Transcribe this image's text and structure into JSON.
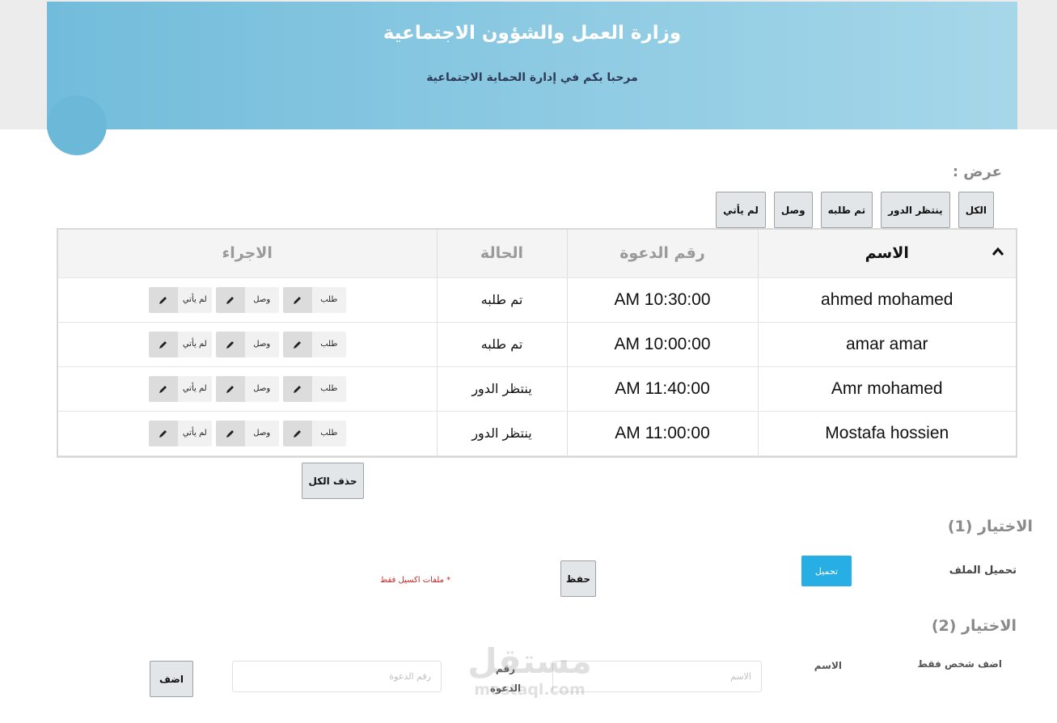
{
  "header": {
    "title": "وزارة العمل والشؤون الاجتماعية",
    "subtitle": "مرحبا بكم في إدارة الحماية الاجتماعية"
  },
  "filters": {
    "label": "عرض :",
    "buttons": [
      "الكل",
      "ينتظر الدور",
      "تم طلبه",
      "وصل",
      "لم يأتي"
    ]
  },
  "table": {
    "columns": {
      "name": "الاسم",
      "call_number": "رقم الدعوة",
      "status": "الحالة",
      "action": "الاجراء"
    },
    "sort_icon": "chevron-up-icon",
    "action_labels": {
      "request": "طلب",
      "arrived": "وصل",
      "not_came": "لم يأتي"
    },
    "rows": [
      {
        "name": "ahmed mohamed",
        "call_time": "AM 10:30:00",
        "status": "تم طلبه"
      },
      {
        "name": "amar amar",
        "call_time": "AM 10:00:00",
        "status": "تم طلبه"
      },
      {
        "name": "Amr mohamed",
        "call_time": "AM 11:40:00",
        "status": "ينتظر الدور"
      },
      {
        "name": "Mostafa hossien",
        "call_time": "AM 11:00:00",
        "status": "ينتظر الدور"
      }
    ]
  },
  "delete_all_label": "حذف الكل",
  "option1": {
    "title": "الاختيار (1)",
    "upload_label": "تحميل الملف",
    "upload_button": "تحميل",
    "save_button": "حفظ",
    "note": "* ملفات اكسيل فقط"
  },
  "option2": {
    "title": "الاختيار (2)",
    "add_one_label": "اضف شخص فقط",
    "name_label": "الاسم",
    "name_placeholder": "الاسم",
    "call_label": "رقم الدعوة",
    "call_placeholder": "رقم الدعوة",
    "add_button": "اضف"
  },
  "watermark": {
    "arabic": "مستقل",
    "latin": "mostaql.com"
  },
  "colors": {
    "header_start": "#72bcdb",
    "header_end": "#a6d7e9",
    "upload_blue": "#27aee5",
    "note_red": "#c62828"
  }
}
